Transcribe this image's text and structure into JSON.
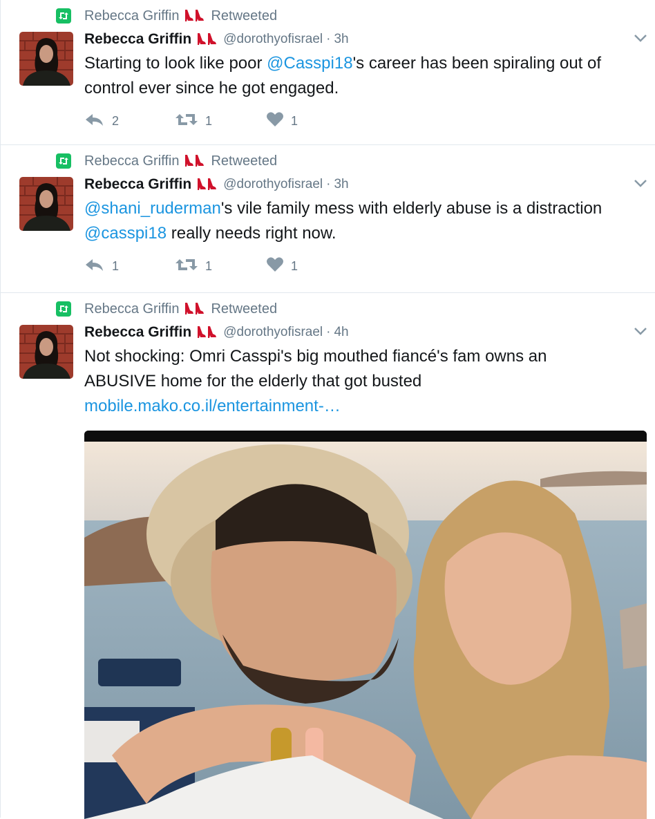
{
  "retweeter": {
    "name": "Rebecca Griffin",
    "label": "Retweeted"
  },
  "tweets": [
    {
      "author_name": "Rebecca Griffin",
      "handle": "@dorothyofisrael",
      "separator": "·",
      "time": "3h",
      "text_parts": [
        "Starting to look like poor ",
        "@Casspi18",
        "'s career has been spiraling out of control ever since he got engaged."
      ],
      "stats": {
        "replies": "2",
        "retweets": "1",
        "likes": "1"
      }
    },
    {
      "author_name": "Rebecca Griffin",
      "handle": "@dorothyofisrael",
      "separator": "·",
      "time": "3h",
      "text_parts": [
        "@shani_ruderman",
        "'s vile family mess with elderly abuse is a distraction ",
        "@casspi18",
        " really needs right now."
      ],
      "stats": {
        "replies": "1",
        "retweets": "1",
        "likes": "1"
      }
    },
    {
      "author_name": "Rebecca Griffin",
      "handle": "@dorothyofisrael",
      "separator": "·",
      "time": "4h",
      "text_parts": [
        "Not shocking: Omri Casspi's big mouthed fiancé's fam owns an ABUSIVE home for the elderly that got busted",
        "mobile.mako.co.il/entertainment-…"
      ]
    }
  ],
  "colors": {
    "link": "#1b95e0",
    "retweet_badge": "#17bf63",
    "muted": "#657786",
    "heel": "#d0112b"
  },
  "icons": [
    "retweet-badge-icon",
    "high-heel-icon",
    "chevron-down-icon",
    "reply-icon",
    "retweet-icon",
    "heart-icon"
  ]
}
